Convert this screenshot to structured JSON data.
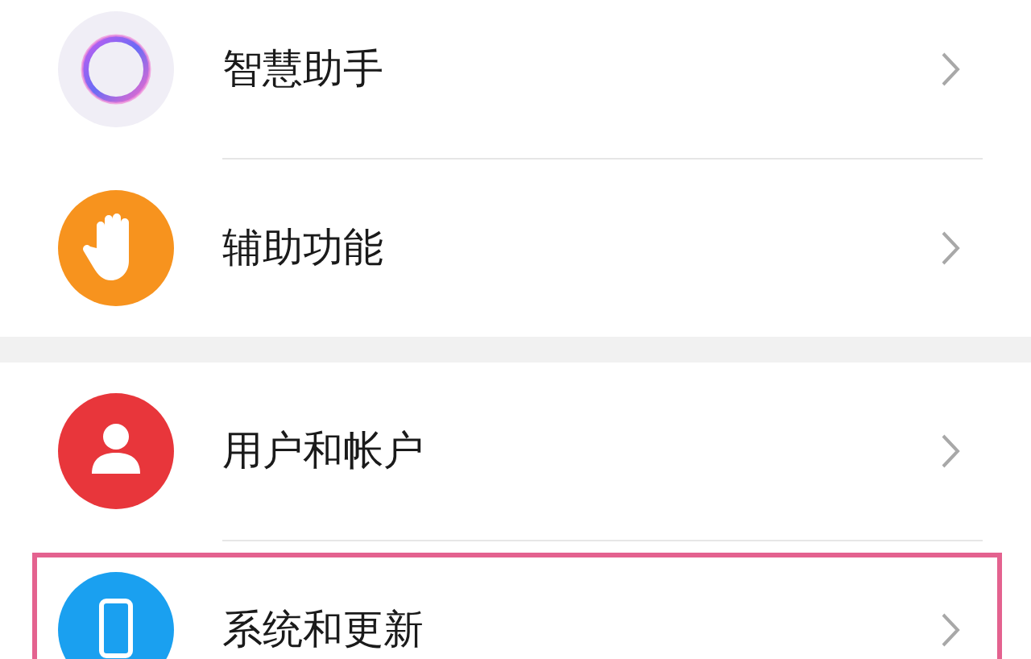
{
  "groups": [
    {
      "items": [
        {
          "label": "智慧助手",
          "kind": "assistant",
          "color": "#f0eef6",
          "highlighted": false
        },
        {
          "label": "辅助功能",
          "kind": "hand",
          "color": "#f7931e",
          "highlighted": false
        }
      ]
    },
    {
      "items": [
        {
          "label": "用户和帐户",
          "kind": "user",
          "color": "#e8363b",
          "highlighted": false
        },
        {
          "label": "系统和更新",
          "kind": "phone",
          "color": "#1aa0f0",
          "highlighted": true
        }
      ]
    }
  ]
}
